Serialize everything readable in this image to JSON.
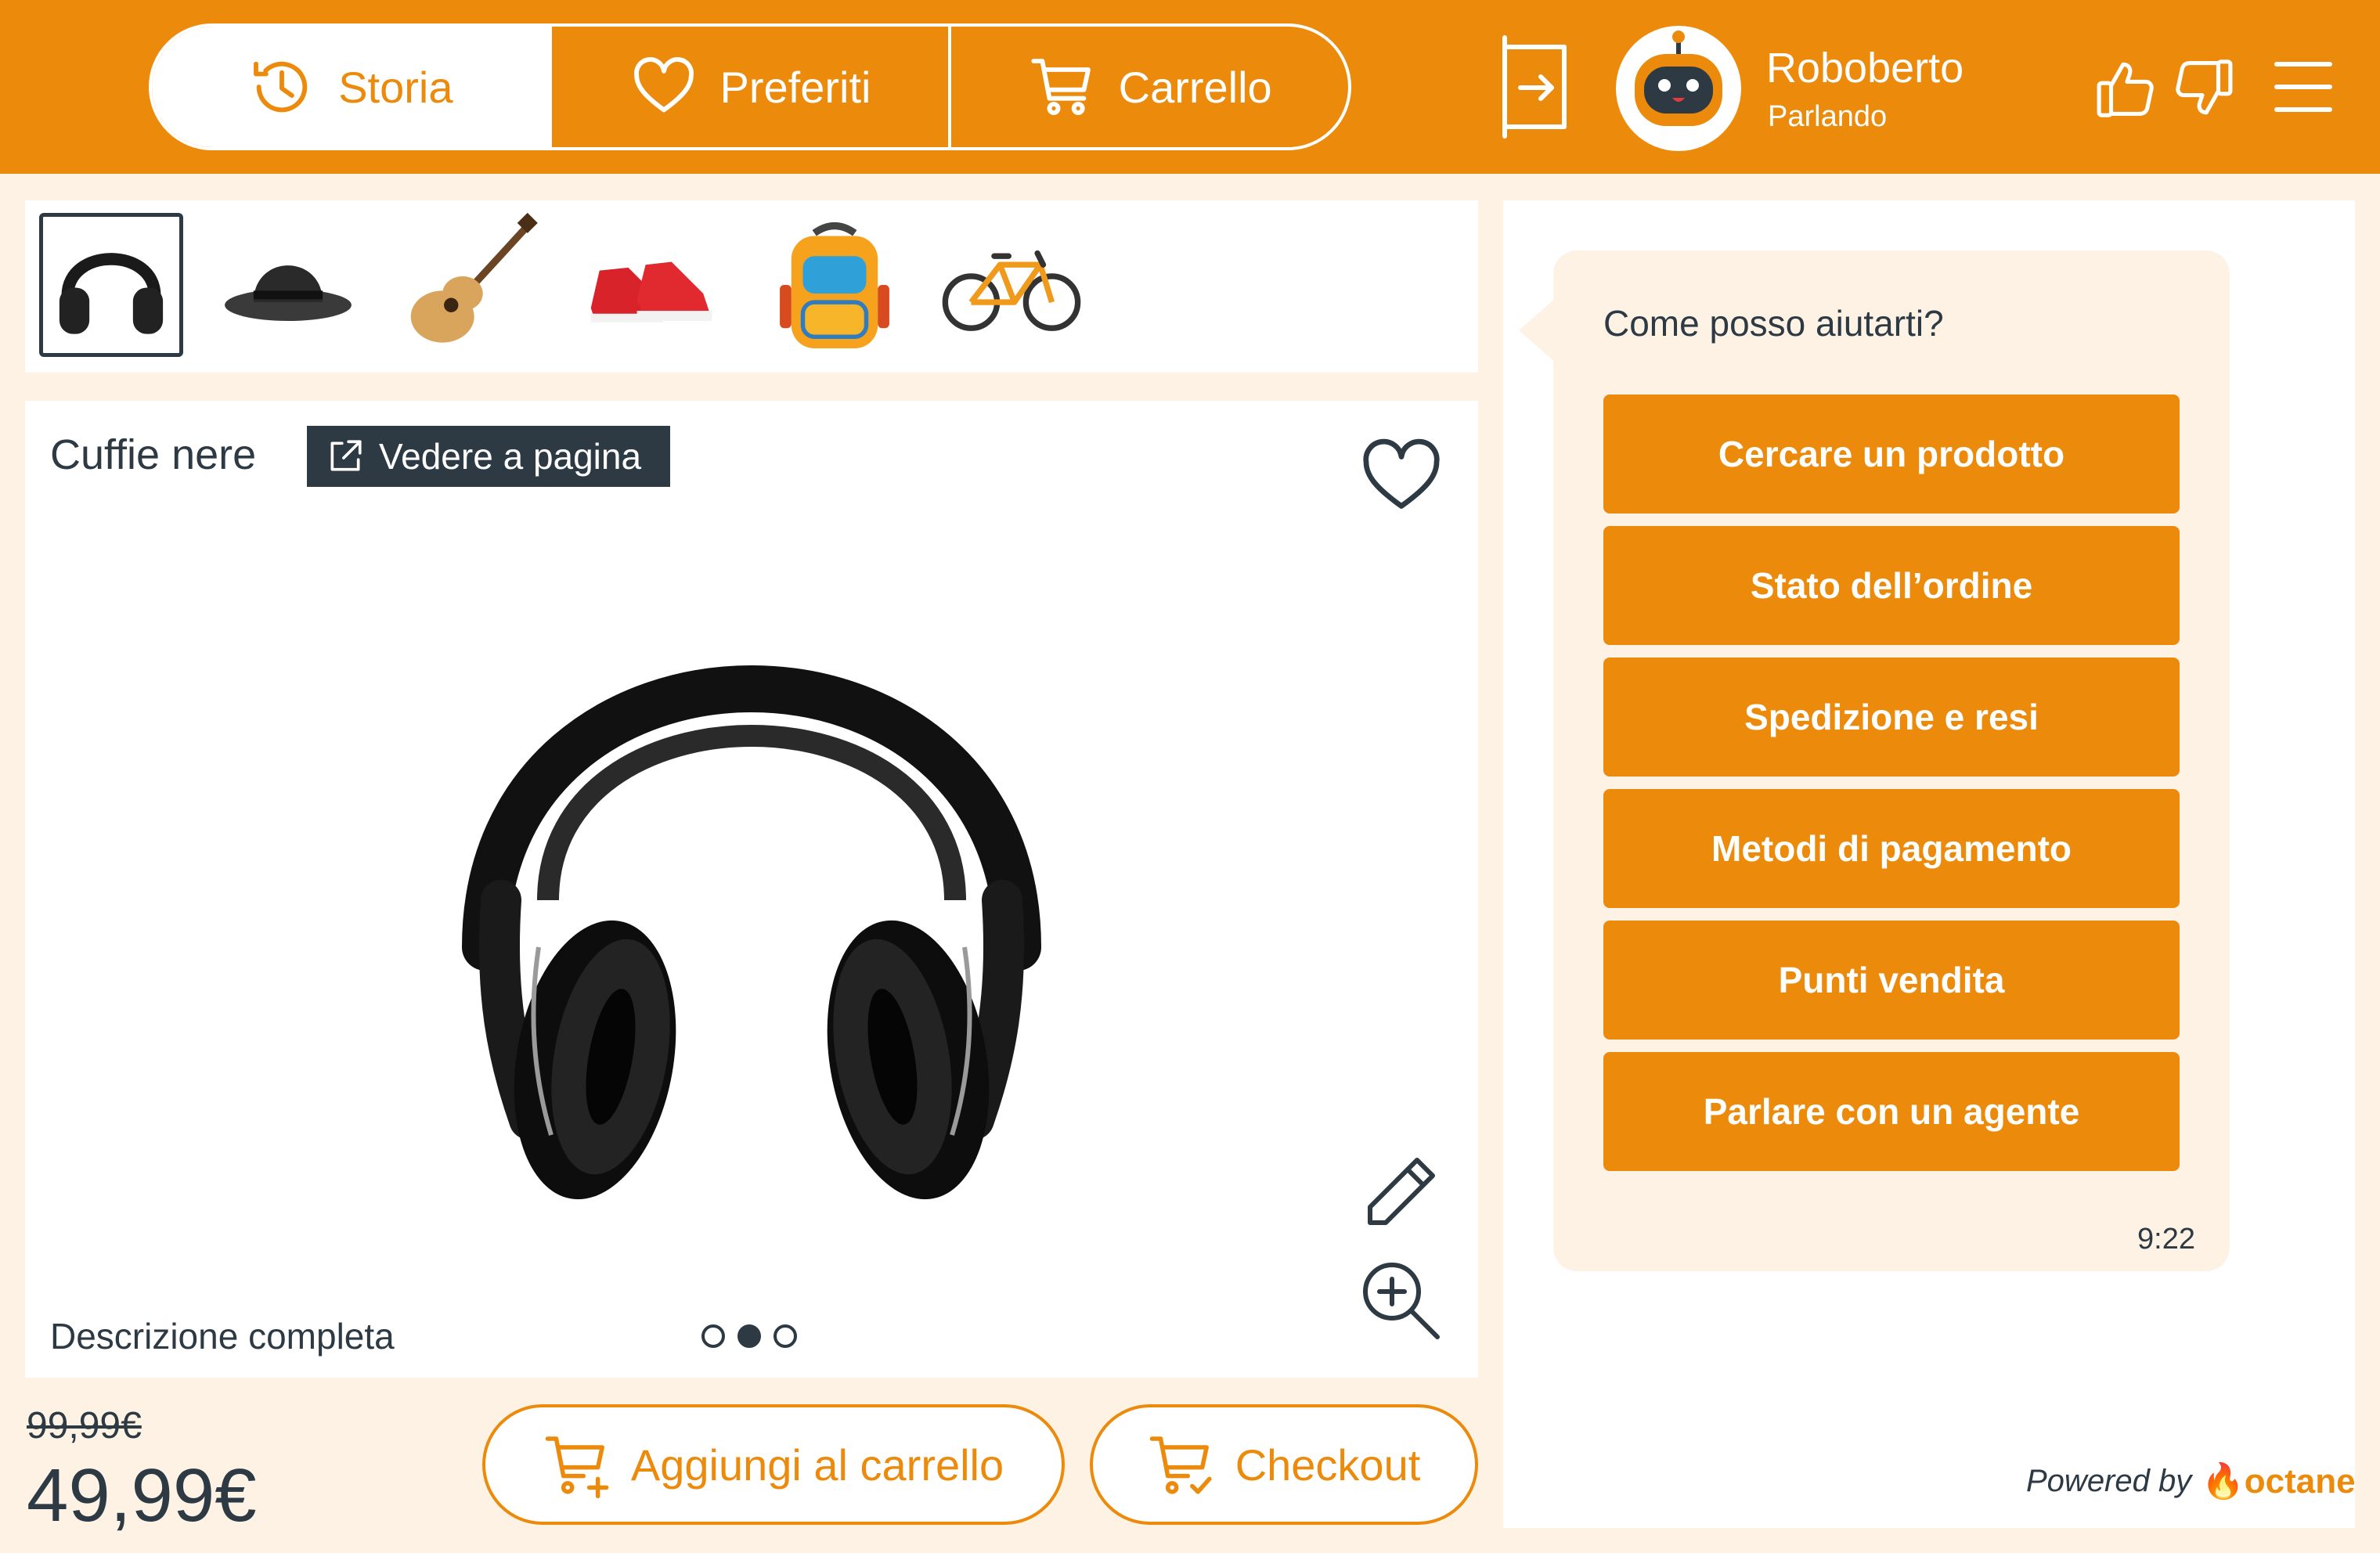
{
  "header": {
    "tabs": [
      {
        "label": "Storia",
        "icon": "history-icon",
        "active": true
      },
      {
        "label": "Preferiti",
        "icon": "heart-icon",
        "active": false
      },
      {
        "label": "Carrello",
        "icon": "cart-icon",
        "active": false
      }
    ],
    "bot": {
      "name": "Roboberto",
      "status": "Parlando"
    }
  },
  "strip": {
    "items": [
      {
        "name": "headphones",
        "selected": true
      },
      {
        "name": "bowler-hat",
        "selected": false
      },
      {
        "name": "acoustic-guitar",
        "selected": false
      },
      {
        "name": "red-sneakers",
        "selected": false
      },
      {
        "name": "backpack",
        "selected": false
      },
      {
        "name": "bicycle",
        "selected": false
      }
    ]
  },
  "product": {
    "title": "Cuffie nere",
    "view_page_label": "Vedere a pagina",
    "description_link": "Descrizione completa",
    "old_price": "99,99€",
    "price": "49,99€",
    "carousel": {
      "count": 3,
      "active_index": 1
    }
  },
  "actions": {
    "add_to_cart": "Aggiungi al carrello",
    "checkout": "Checkout"
  },
  "chat": {
    "greeting": "Come posso aiutarti?",
    "options": [
      "Cercare un prodotto",
      "Stato dell’ordine",
      "Spedizione e resi",
      "Metodi di pagamento",
      "Punti vendita",
      "Parlare con un agente"
    ],
    "time": "9:22",
    "powered_by": "Powered by",
    "brand": "octane"
  },
  "colors": {
    "accent": "#ec8a0c",
    "dark": "#2d3a44",
    "background": "#fdf2e4"
  }
}
